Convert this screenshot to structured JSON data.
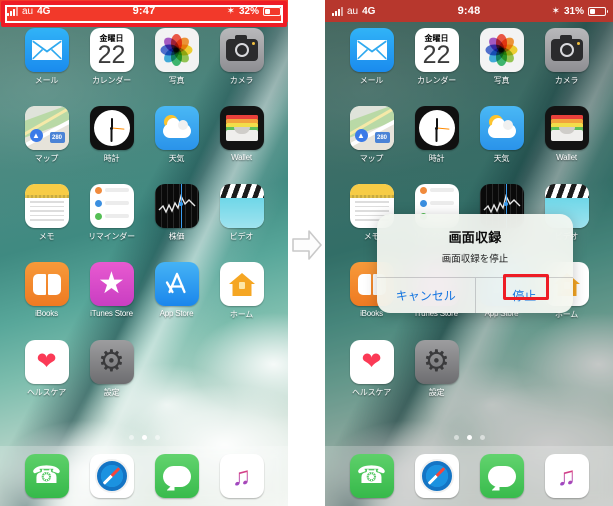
{
  "left_phone": {
    "status_bar": {
      "signal_icon": "signal-bars-icon",
      "carrier": "au",
      "network": "4G",
      "time": "9:47",
      "bluetooth_icon": "bluetooth-icon",
      "battery_percent": "32%",
      "battery_level": 32,
      "recording_color": "#f2392a"
    },
    "annotation": {
      "target": "status-bar",
      "color": "#ee1c25"
    }
  },
  "right_phone": {
    "status_bar": {
      "signal_icon": "signal-bars-icon",
      "carrier": "au",
      "network": "4G",
      "time": "9:48",
      "bluetooth_icon": "bluetooth-icon",
      "battery_percent": "31%",
      "battery_level": 31,
      "recording_color": "#b7372d"
    },
    "alert": {
      "title": "画面収録",
      "message": "画面収録を停止",
      "cancel_label": "キャンセル",
      "confirm_label": "停止",
      "accent_color": "#1474e0"
    },
    "annotation": {
      "target": "stop-button",
      "color": "#ee1c25"
    }
  },
  "home_screen": {
    "apps": [
      {
        "label": "メール",
        "icon": "mail-icon"
      },
      {
        "label": "カレンダー",
        "icon": "calendar-icon",
        "day_of_week": "金曜日",
        "day_number": "22"
      },
      {
        "label": "写真",
        "icon": "photos-icon"
      },
      {
        "label": "カメラ",
        "icon": "camera-icon"
      },
      {
        "label": "マップ",
        "icon": "maps-icon",
        "route_number": "280"
      },
      {
        "label": "時計",
        "icon": "clock-icon"
      },
      {
        "label": "天気",
        "icon": "weather-icon"
      },
      {
        "label": "Wallet",
        "icon": "wallet-icon"
      },
      {
        "label": "メモ",
        "icon": "notes-icon"
      },
      {
        "label": "リマインダー",
        "icon": "reminders-icon"
      },
      {
        "label": "株価",
        "icon": "stocks-icon"
      },
      {
        "label": "ビデオ",
        "icon": "videos-icon"
      },
      {
        "label": "iBooks",
        "icon": "ibooks-icon"
      },
      {
        "label": "iTunes Store",
        "icon": "itunes-store-icon"
      },
      {
        "label": "App Store",
        "icon": "app-store-icon"
      },
      {
        "label": "ホーム",
        "icon": "home-app-icon"
      },
      {
        "label": "ヘルスケア",
        "icon": "health-icon"
      },
      {
        "label": "設定",
        "icon": "settings-icon"
      }
    ],
    "dock": [
      {
        "label": "電話",
        "icon": "phone-icon"
      },
      {
        "label": "Safari",
        "icon": "safari-icon"
      },
      {
        "label": "メッセージ",
        "icon": "messages-icon"
      },
      {
        "label": "ミュージック",
        "icon": "music-icon"
      }
    ],
    "page_dots": {
      "count": 3,
      "active_index": 1
    }
  },
  "flow": {
    "arrow_icon": "arrow-right-icon"
  }
}
